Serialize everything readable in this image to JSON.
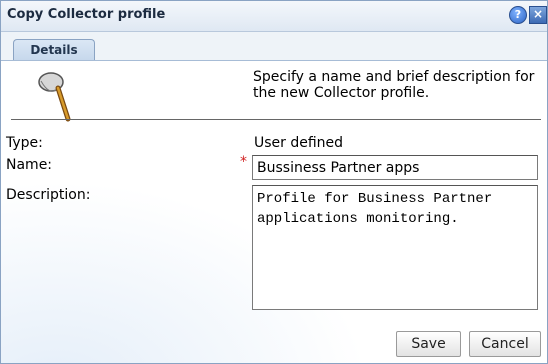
{
  "dialog": {
    "title": "Copy Collector profile",
    "help_icon": "?",
    "close_icon": "×"
  },
  "tabs": [
    {
      "label": "Details"
    }
  ],
  "intro": {
    "icon": "butterfly-net-icon",
    "text": "Specify a name and brief description for the new Collector profile."
  },
  "form": {
    "type_label": "Type:",
    "type_value": "User defined",
    "name_label": "Name:",
    "required_marker": "*",
    "name_value": "Bussiness Partner apps",
    "description_label": "Description:",
    "description_value": "Profile for Business Partner applications monitoring."
  },
  "buttons": {
    "save": "Save",
    "cancel": "Cancel"
  },
  "colors": {
    "title_bar": "#dfe8f3",
    "tab": "#c7d8ec",
    "required": "#d02020"
  }
}
